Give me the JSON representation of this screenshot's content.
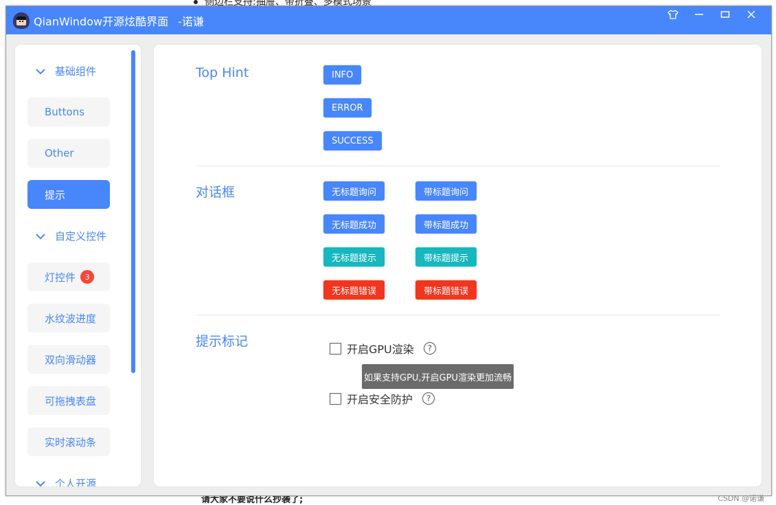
{
  "background": {
    "top_text": "侧边栏支持:抽屉、带折叠、多模式场景",
    "bottom_text": "请大家不要说什么抄袭了;"
  },
  "window": {
    "title": "QianWindow开源炫酷界面",
    "author": "-诺谦",
    "controls": {
      "skin": "skin-icon",
      "minimize": "minimize-icon",
      "maximize": "maximize-icon",
      "close": "close-icon"
    }
  },
  "sidebar": {
    "groups": [
      {
        "label": "基础组件",
        "expanded": true,
        "items": [
          {
            "label": "Buttons",
            "active": false
          },
          {
            "label": "Other",
            "active": false
          },
          {
            "label": "提示",
            "active": true
          }
        ]
      },
      {
        "label": "自定义控件",
        "expanded": true,
        "items": [
          {
            "label": "灯控件",
            "active": false,
            "badge": "3"
          },
          {
            "label": "水纹波进度",
            "active": false
          },
          {
            "label": "双向滑动器",
            "active": false
          },
          {
            "label": "可拖拽表盘",
            "active": false
          },
          {
            "label": "实时滚动条",
            "active": false
          }
        ]
      },
      {
        "label": "个人开源",
        "expanded": true,
        "items": []
      }
    ]
  },
  "main": {
    "sections": {
      "top_hint": {
        "label": "Top Hint",
        "buttons": [
          "INFO",
          "ERROR",
          "SUCCESS"
        ]
      },
      "dialog": {
        "label": "对话框",
        "buttons": [
          [
            "无标题询问",
            "带标题询问"
          ],
          [
            "无标题成功",
            "带标题成功"
          ],
          [
            "无标题提示",
            "带标题提示"
          ],
          [
            "无标题错误",
            "带标题错误"
          ]
        ]
      },
      "hint_mark": {
        "label": "提示标记",
        "checks": [
          {
            "label": "开启GPU渲染",
            "checked": false,
            "help": "?"
          },
          {
            "label": "开启安全防护",
            "checked": false,
            "help": "?"
          }
        ],
        "tooltip": "如果支持GPU,开启GPU渲染更加流畅"
      }
    }
  },
  "colors": {
    "primary": "#4886fb",
    "teal": "#17b7bf",
    "danger": "#f0361f",
    "badge": "#f5483b"
  },
  "watermark": "CSDN @诺谦"
}
